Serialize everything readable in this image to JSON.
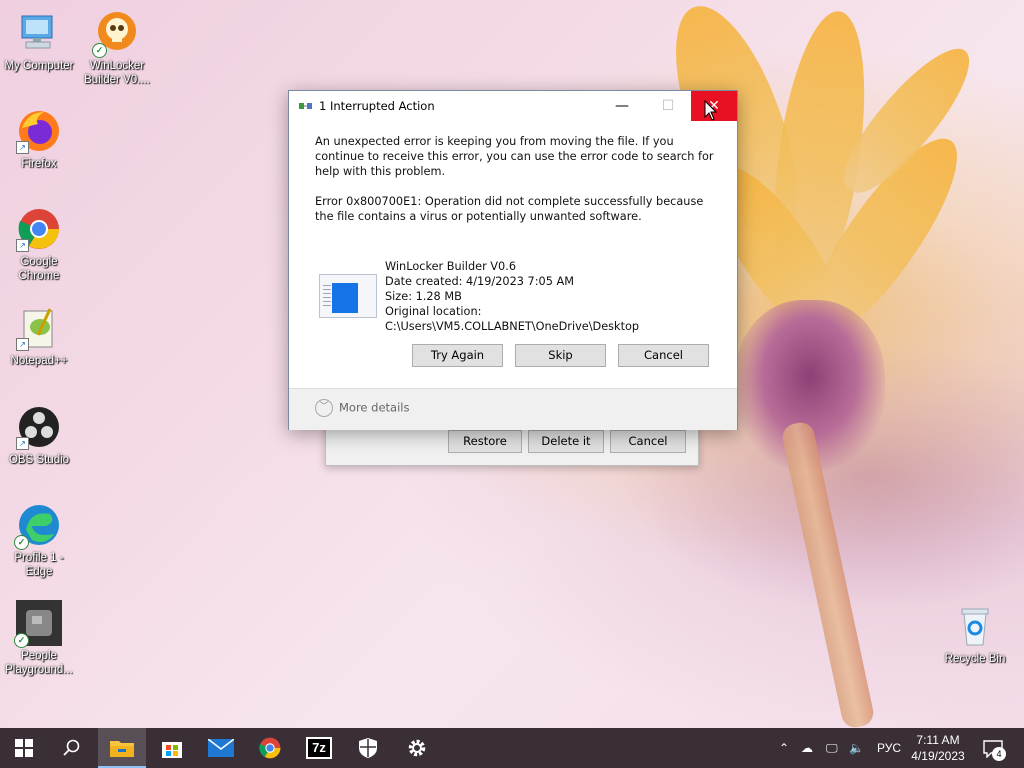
{
  "desktop": {
    "icons": [
      {
        "label": "My Computer",
        "icon": "computer-icon"
      },
      {
        "label": "WinLocker Builder V0....",
        "icon": "skull-icon"
      },
      {
        "label": "Firefox",
        "icon": "firefox-icon"
      },
      {
        "label": "Google Chrome",
        "icon": "chrome-icon"
      },
      {
        "label": "Notepad++",
        "icon": "notepadpp-icon"
      },
      {
        "label": "OBS Studio",
        "icon": "obs-icon"
      },
      {
        "label": "Profile 1 - Edge",
        "icon": "edge-icon"
      },
      {
        "label": "People Playground...",
        "icon": "people-playground-icon"
      },
      {
        "label": "Recycle Bin",
        "icon": "recycle-bin-icon"
      }
    ]
  },
  "back_dialog": {
    "restore": "Restore",
    "delete": "Delete it",
    "cancel": "Cancel"
  },
  "dialog": {
    "title": "1 Interrupted Action",
    "message": "An unexpected error is keeping you from moving the file. If you continue to receive this error, you can use the error code to search for help with this problem.",
    "error": "Error 0x800700E1: Operation did not complete successfully because the file contains a virus or potentially unwanted software.",
    "file": {
      "name": "WinLocker Builder V0.6",
      "date_created": "Date created: 4/19/2023 7:05 AM",
      "size": "Size: 1.28 MB",
      "location_label": "Original location:",
      "location": "C:\\Users\\VM5.COLLABNET\\OneDrive\\Desktop"
    },
    "buttons": {
      "try_again": "Try Again",
      "skip": "Skip",
      "cancel": "Cancel"
    },
    "more_details": "More details",
    "window_controls": {
      "minimize": "—",
      "maximize": "☐",
      "close": "✕"
    }
  },
  "taskbar": {
    "items": [
      "start-icon",
      "search-icon",
      "file-explorer-icon",
      "store-icon",
      "mail-icon",
      "chrome-icon",
      "7zip-icon",
      "security-icon",
      "settings-icon"
    ],
    "seven_zip": "7z",
    "language": "РУС",
    "time": "7:11 AM",
    "date": "4/19/2023",
    "notification_count": "4"
  },
  "colors": {
    "close_red": "#e81123",
    "taskbar": "#3a2f37",
    "accent": "#1473e6"
  }
}
